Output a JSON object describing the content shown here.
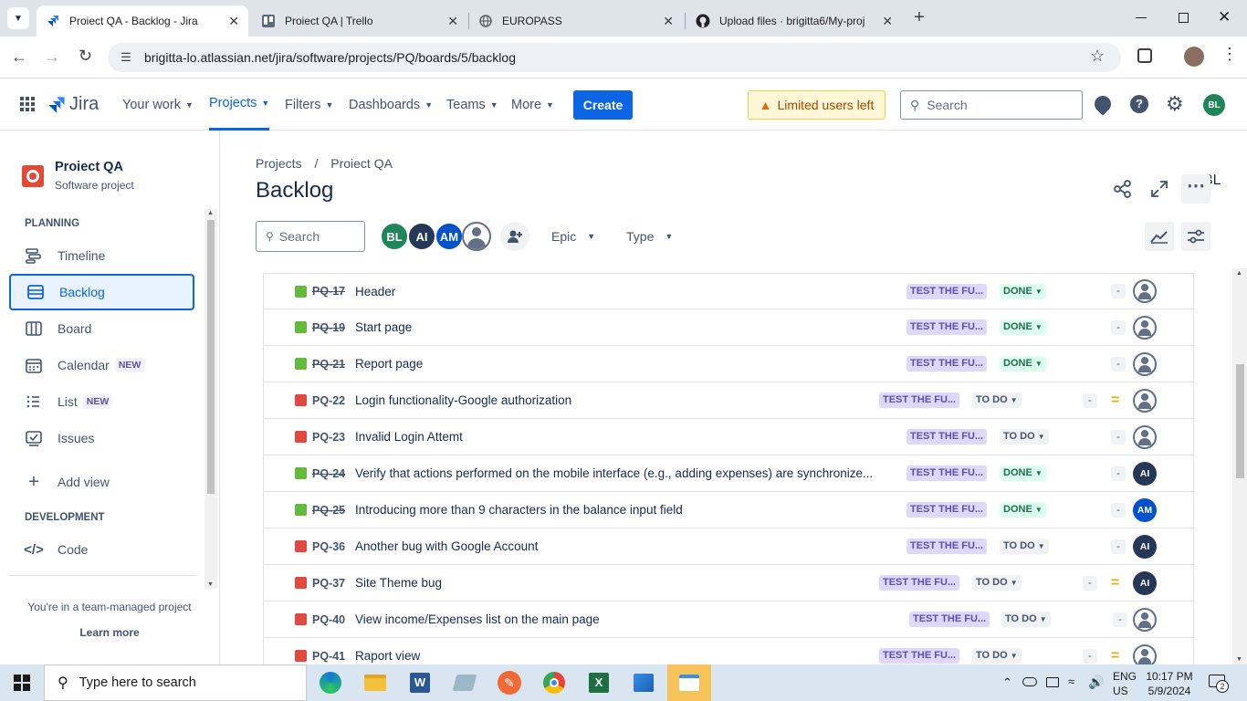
{
  "browser": {
    "tabs": [
      {
        "title": "Proiect QA - Backlog - Jira",
        "active": true,
        "icon": "jira-icon"
      },
      {
        "title": "Proiect QA | Trello",
        "active": false,
        "icon": "trello-icon"
      },
      {
        "title": "EUROPASS",
        "active": false,
        "icon": "globe-icon"
      },
      {
        "title": "Upload files · brigitta6/My-proj",
        "active": false,
        "icon": "github-icon"
      }
    ],
    "url": "brigitta-lo.atlassian.net/jira/software/projects/PQ/boards/5/backlog"
  },
  "jira_nav": {
    "logo": "Jira",
    "items": [
      "Your work",
      "Projects",
      "Filters",
      "Dashboards",
      "Teams",
      "More"
    ],
    "selected": "Projects",
    "create": "Create",
    "limited": "Limited users left",
    "search_placeholder": "Search",
    "avatar": "BL"
  },
  "sidebar": {
    "project_name": "Proiect QA",
    "project_type": "Software project",
    "planning_header": "PLANNING",
    "planning_items": [
      {
        "label": "Timeline",
        "icon": "timeline-icon"
      },
      {
        "label": "Backlog",
        "icon": "backlog-icon",
        "selected": true
      },
      {
        "label": "Board",
        "icon": "board-icon"
      },
      {
        "label": "Calendar",
        "icon": "calendar-icon",
        "badge": "NEW"
      },
      {
        "label": "List",
        "icon": "list-icon",
        "badge": "NEW"
      },
      {
        "label": "Issues",
        "icon": "issues-icon"
      }
    ],
    "add_view": "Add view",
    "dev_header": "DEVELOPMENT",
    "code": "Code",
    "footer_text": "You're in a team-managed project",
    "learn_more": "Learn more"
  },
  "main": {
    "breadcrumb_projects": "Projects",
    "breadcrumb_sep": "/",
    "breadcrumb_project": "Proiect QA",
    "title": "Backlog",
    "search_placeholder": "Search",
    "avatars": [
      "BL",
      "AI",
      "AM"
    ],
    "filter_epic": "Epic",
    "filter_type": "Type"
  },
  "issues": [
    {
      "key": "PQ-17",
      "summary": "Header",
      "type": "story",
      "epic": "TEST THE FU...",
      "status": "DONE",
      "assignee": ""
    },
    {
      "key": "PQ-19",
      "summary": "Start page",
      "type": "story",
      "epic": "TEST THE FU...",
      "status": "DONE",
      "assignee": ""
    },
    {
      "key": "PQ-21",
      "summary": "Report page",
      "type": "story",
      "epic": "TEST THE FU...",
      "status": "DONE",
      "assignee": ""
    },
    {
      "key": "PQ-22",
      "summary": "Login functionality-Google authorization",
      "type": "bug",
      "epic": "TEST THE FU...",
      "status": "TO DO",
      "priority": "medium",
      "assignee": ""
    },
    {
      "key": "PQ-23",
      "summary": "Invalid Login Attemt",
      "type": "bug",
      "epic": "TEST THE FU...",
      "status": "TO DO",
      "assignee": ""
    },
    {
      "key": "PQ-24",
      "summary": "Verify that actions performed on the mobile interface (e.g., adding expenses) are synchronize...",
      "type": "story",
      "epic": "TEST THE FU...",
      "status": "DONE",
      "assignee": "AI"
    },
    {
      "key": "PQ-25",
      "summary": "Introducing more than 9 characters in the balance input field",
      "type": "story",
      "epic": "TEST THE FU...",
      "status": "DONE",
      "assignee": "AM"
    },
    {
      "key": "PQ-36",
      "summary": "Another bug with Google Account",
      "type": "bug",
      "epic": "TEST THE FU...",
      "status": "TO DO",
      "assignee": "AI"
    },
    {
      "key": "PQ-37",
      "summary": "Site Theme bug",
      "type": "bug",
      "epic": "TEST THE FU...",
      "status": "TO DO",
      "priority": "medium",
      "assignee": "AI"
    },
    {
      "key": "PQ-40",
      "summary": "View income/Expenses list on the main page",
      "type": "bug",
      "epic": "TEST THE FU...",
      "status": "TO DO",
      "assignee": ""
    },
    {
      "key": "PQ-41",
      "summary": "Raport view",
      "type": "bug",
      "epic": "TEST THE FU...",
      "status": "TO DO",
      "priority": "medium",
      "assignee": ""
    }
  ],
  "estimate_dash": "-",
  "taskbar": {
    "search_placeholder": "Type here to search",
    "lang": "ENG",
    "region": "US",
    "time": "10:17 PM",
    "date": "5/9/2024",
    "notif": "2"
  },
  "colors": {
    "brand": "#0c66e4",
    "bug": "#e2483d",
    "story": "#63ba3c",
    "avatar_ai": "#253858",
    "avatar_am": "#0052cc",
    "avatar_bl": "#1f845a"
  }
}
